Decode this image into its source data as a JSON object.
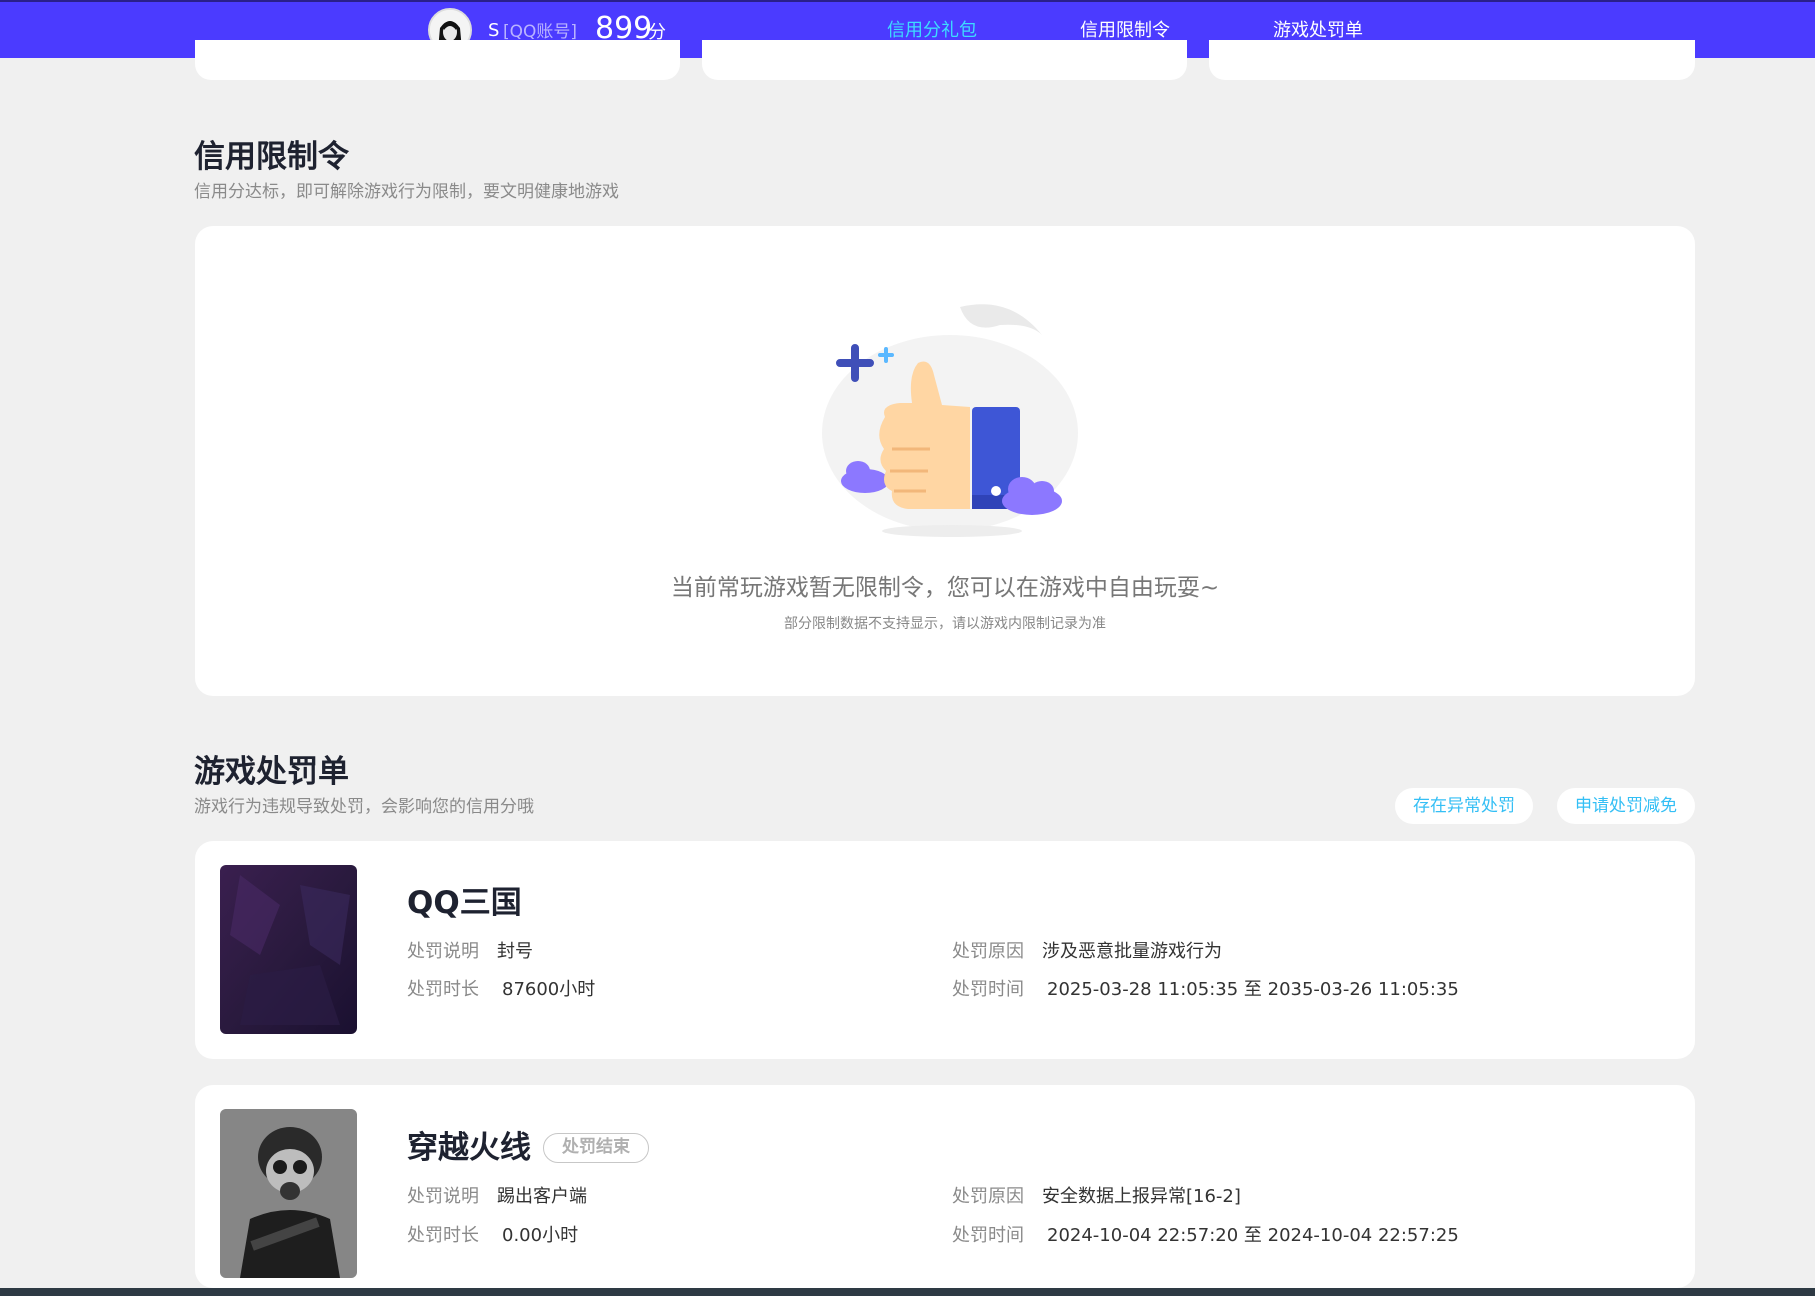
{
  "header": {
    "username": "S",
    "account_tag": "[QQ账号]",
    "score": "899",
    "score_unit": "分",
    "tabs": [
      {
        "label": "信用分礼包",
        "active": true
      },
      {
        "label": "信用限制令",
        "active": false
      },
      {
        "label": "游戏处罚单",
        "active": false
      }
    ]
  },
  "restriction": {
    "title": "信用限制令",
    "subtitle": "信用分达标，即可解除游戏行为限制，要文明健康地游戏",
    "empty_message": "当前常玩游戏暂无限制令，您可以在游戏中自由玩耍~",
    "empty_note": "部分限制数据不支持显示，请以游戏内限制记录为准",
    "illustration_icon": "thumbs-up-illustration"
  },
  "penalty": {
    "title": "游戏处罚单",
    "subtitle": "游戏行为违规导致处罚，会影响您的信用分哦",
    "report_abnormal_label": "存在异常处罚",
    "apply_reduction_label": "申请处罚减免",
    "labels": {
      "description": "处罚说明",
      "duration": "处罚时长",
      "reason": "处罚原因",
      "time": "处罚时间"
    },
    "records": [
      {
        "game": "QQ三国",
        "status": "",
        "description": "封号",
        "duration": "87600小时",
        "reason": "涉及恶意批量游戏行为",
        "time": "2025-03-28 11:05:35 至 2035-03-26 11:05:35"
      },
      {
        "game": "穿越火线",
        "status": "处罚结束",
        "description": "踢出客户端",
        "duration": "0.00小时",
        "reason": "安全数据上报异常[16-2]",
        "time": "2024-10-04 22:57:20 至 2024-10-04 22:57:25"
      }
    ]
  },
  "colors": {
    "topbar": "#4b3bff",
    "accent": "#3ddcff",
    "link": "#34bff5"
  }
}
